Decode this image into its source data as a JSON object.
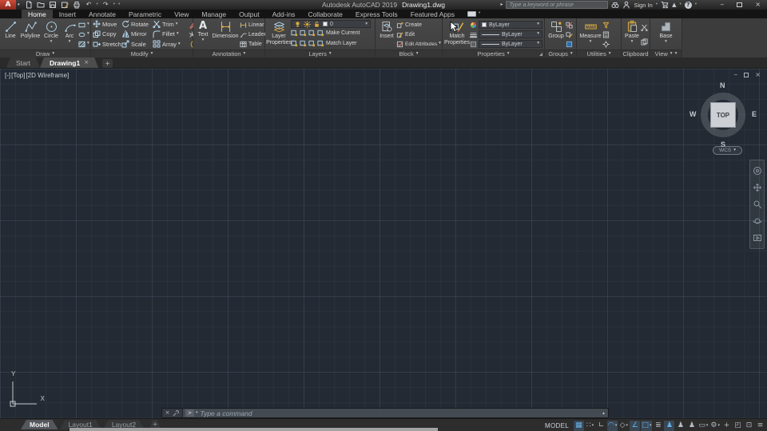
{
  "colors": {
    "brand_red": "#c0392b",
    "accent_blue": "#64b2e8",
    "gold": "#d9a93f",
    "canvas_bg": "#232a33"
  },
  "titlebar": {
    "app": "Autodesk AutoCAD 2019",
    "doc": "Drawing1.dwg",
    "search_placeholder": "Type a keyword or phrase",
    "sign_in": "Sign In"
  },
  "tabs": {
    "t0": "Home",
    "t1": "Insert",
    "t2": "Annotate",
    "t3": "Parametric",
    "t4": "View",
    "t5": "Manage",
    "t6": "Output",
    "t7": "Add-ins",
    "t8": "Collaborate",
    "t9": "Express Tools",
    "t10": "Featured Apps"
  },
  "ribbon": {
    "draw": {
      "label": "Draw",
      "line": "Line",
      "polyline": "Polyline",
      "circle": "Circle",
      "arc": "Arc"
    },
    "modify": {
      "label": "Modify",
      "move": "Move",
      "rotate": "Rotate",
      "trim": "Trim",
      "copy": "Copy",
      "mirror": "Mirror",
      "fillet": "Fillet",
      "stretch": "Stretch",
      "scale": "Scale",
      "array": "Array"
    },
    "annotation": {
      "label": "Annotation",
      "text": "Text",
      "dimension": "Dimension",
      "linear": "Linear",
      "leader": "Leader",
      "table": "Table"
    },
    "layers": {
      "label": "Layers",
      "big": "Layer Properties",
      "current": "0",
      "make_current": "Make Current",
      "match_layer": "Match Layer"
    },
    "block": {
      "label": "Block",
      "insert": "Insert",
      "create": "Create",
      "edit": "Edit",
      "edit_attributes": "Edit Attributes"
    },
    "properties": {
      "label": "Properties",
      "big": "Match Properties",
      "color": "ByLayer",
      "lineweight": "ByLayer",
      "linetype": "ByLayer"
    },
    "groups": {
      "label": "Groups",
      "group": "Group"
    },
    "utilities": {
      "label": "Utilities",
      "measure": "Measure"
    },
    "clipboard": {
      "label": "Clipboard",
      "paste": "Paste"
    },
    "view": {
      "label": "View",
      "base": "Base"
    }
  },
  "file_tabs": {
    "start": "Start",
    "drawing": "Drawing1"
  },
  "viewport": {
    "vp_menu": "[-]",
    "vp_view": "[Top]",
    "vp_visual": "[2D Wireframe]",
    "n": "N",
    "s": "S",
    "e": "E",
    "w": "W",
    "top": "TOP",
    "wcs": "WCS",
    "ucs_x": "X",
    "ucs_y": "Y"
  },
  "command": {
    "placeholder": "Type a command"
  },
  "statusbar": {
    "model": "Model",
    "layout1": "Layout1",
    "layout2": "Layout2",
    "badge": "MODEL"
  },
  "icons": {
    "caret": "▾",
    "close": "×",
    "minimize": "‒",
    "undo": "↶",
    "redo": "↷",
    "expand": "▸",
    "prompt": ">",
    "up": "▴",
    "help": "?",
    "exchange": "▲",
    "text_a": "A",
    "grid": "▦",
    "snap": "∷",
    "ortho": "∟",
    "polar": "◠",
    "isodraft": "◇",
    "otrack": "∠",
    "osnap": "□",
    "lweight": "≣",
    "person": "♟",
    "scalebox": "▭",
    "gear": "⚙",
    "plus": "+",
    "isolate": "◰",
    "clean": "⊡",
    "menu": "≡"
  }
}
